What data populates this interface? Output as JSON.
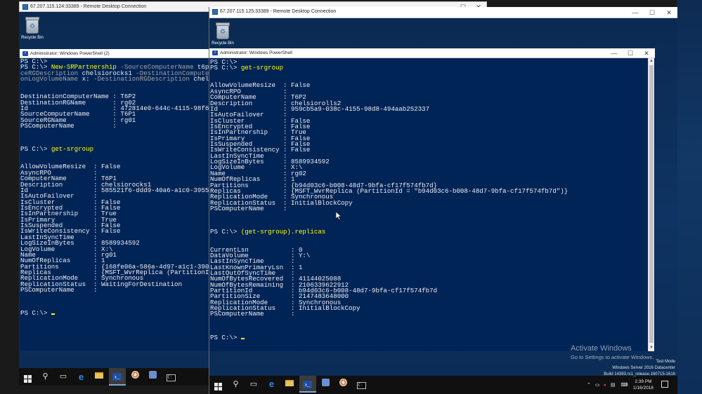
{
  "left_rdp": {
    "title": "67.207.115.124:33389 - Remote Desktop Connection",
    "recycle_bin_label": "Recycle Bin",
    "ps_window_title": "Administrator: Windows PowerShell (2)"
  },
  "left_ps_lines": [
    [
      {
        "t": "PS C:\\>",
        "c": ""
      }
    ],
    [
      {
        "t": "PS C:\\> ",
        "c": ""
      },
      {
        "t": "New-SRPartnership",
        "c": "y"
      },
      {
        "t": " -SourceComputerName",
        "c": "g"
      },
      {
        "t": " t6p1",
        "c": ""
      }
    ],
    [
      {
        "t": "ceRGDescription",
        "c": "g"
      },
      {
        "t": " chelsiorocks1",
        "c": ""
      },
      {
        "t": " -DestinationComputerN",
        "c": "g"
      }
    ],
    [
      {
        "t": "onLogVolumeName",
        "c": "g"
      },
      {
        "t": " x: ",
        "c": ""
      },
      {
        "t": "-DestinationRGDescription",
        "c": "g"
      },
      {
        "t": " chelsi",
        "c": ""
      }
    ],
    [
      {
        "t": "",
        "c": ""
      }
    ],
    [
      {
        "t": "",
        "c": ""
      }
    ],
    [
      {
        "t": "DestinationComputerName : T6P2",
        "c": ""
      }
    ],
    [
      {
        "t": "DestinationRGName       : rg02",
        "c": ""
      }
    ],
    [
      {
        "t": "Id                      : 472814e0-644c-4115-98f6-a",
        "c": ""
      }
    ],
    [
      {
        "t": "SourceComputerName      : T6P1",
        "c": ""
      }
    ],
    [
      {
        "t": "SourceRGName            : rg01",
        "c": ""
      }
    ],
    [
      {
        "t": "PSComputerName          :",
        "c": ""
      }
    ],
    [
      {
        "t": "",
        "c": ""
      }
    ],
    [
      {
        "t": "",
        "c": ""
      }
    ],
    [
      {
        "t": "",
        "c": ""
      }
    ],
    [
      {
        "t": "PS C:\\> ",
        "c": ""
      },
      {
        "t": "get-srgroup",
        "c": "y"
      }
    ],
    [
      {
        "t": "",
        "c": ""
      }
    ],
    [
      {
        "t": "",
        "c": ""
      }
    ],
    [
      {
        "t": "AllowVolumeResize  : False",
        "c": ""
      }
    ],
    [
      {
        "t": "AsyncRPO           :",
        "c": ""
      }
    ],
    [
      {
        "t": "ComputerName       : T6P1",
        "c": ""
      }
    ],
    [
      {
        "t": "Description        : chelsiorocks1",
        "c": ""
      }
    ],
    [
      {
        "t": "Id                 : 585521f6-ddd9-40a6-a1c0-3955f4",
        "c": ""
      }
    ],
    [
      {
        "t": "IsAutoFailover     :",
        "c": ""
      }
    ],
    [
      {
        "t": "IsCluster          : False",
        "c": ""
      }
    ],
    [
      {
        "t": "IsEncrypted        : False",
        "c": ""
      }
    ],
    [
      {
        "t": "IsInPartnership    : True",
        "c": ""
      }
    ],
    [
      {
        "t": "IsPrimary          : True",
        "c": ""
      }
    ],
    [
      {
        "t": "IsSuspended        : False",
        "c": ""
      }
    ],
    [
      {
        "t": "IsWriteConsistency : False",
        "c": ""
      }
    ],
    [
      {
        "t": "LastInSyncTime     :",
        "c": ""
      }
    ],
    [
      {
        "t": "LogSizeInBytes     : 8589934592",
        "c": ""
      }
    ],
    [
      {
        "t": "LogVolume          : X:\\",
        "c": ""
      }
    ],
    [
      {
        "t": "Name               : rg01",
        "c": ""
      }
    ],
    [
      {
        "t": "NumOfReplicas      : 1",
        "c": ""
      }
    ],
    [
      {
        "t": "Partitions         : {168fe06a-586a-4d97-a1c1-3907b",
        "c": ""
      }
    ],
    [
      {
        "t": "Replicas           : {MSFT_WvrReplica (PartitionId",
        "c": ""
      }
    ],
    [
      {
        "t": "ReplicationMode    : Synchronous",
        "c": ""
      }
    ],
    [
      {
        "t": "ReplicationStatus  : WaitingForDestination",
        "c": ""
      }
    ],
    [
      {
        "t": "PSComputerName     :",
        "c": ""
      }
    ],
    [
      {
        "t": "",
        "c": ""
      }
    ],
    [
      {
        "t": "",
        "c": ""
      }
    ],
    [
      {
        "t": "",
        "c": ""
      }
    ],
    [
      {
        "t": "PS C:\\> ",
        "c": ""
      },
      {
        "t": "",
        "c": "cursor"
      }
    ]
  ],
  "left_taskbar": [
    "start-button",
    "search-icon",
    "task-view-icon",
    "internet-explorer-icon",
    "file-explorer-icon",
    "powershell-icon",
    "disk-icon",
    "server-manager-icon",
    "cmd-icon"
  ],
  "right_rdp": {
    "title": "67.207.115.125:33389 - Remote Desktop Connection",
    "recycle_bin_label": "Recycle Bin",
    "ps_window_title": "Administrator: Windows PowerShell",
    "watermark_title": "Activate Windows",
    "watermark_sub": "Go to Settings to activate Windows.",
    "build_line1": "Test Mode",
    "build_line2": "Windows Server 2016 Datacenter",
    "build_line3": "Build 14393.rs1_release.160715-1616",
    "clock_time": "2:39 PM",
    "clock_date": "1/16/2018"
  },
  "right_ps_lines": [
    [
      {
        "t": "PS C:\\>",
        "c": ""
      }
    ],
    [
      {
        "t": "PS C:\\> ",
        "c": ""
      },
      {
        "t": "get-srgroup",
        "c": "y"
      }
    ],
    [
      {
        "t": "",
        "c": ""
      }
    ],
    [
      {
        "t": "",
        "c": ""
      }
    ],
    [
      {
        "t": "AllowVolumeResize  : False",
        "c": ""
      }
    ],
    [
      {
        "t": "AsyncRPO           :",
        "c": ""
      }
    ],
    [
      {
        "t": "ComputerName       : T6P2",
        "c": ""
      }
    ],
    [
      {
        "t": "Description        : chelsiorolls2",
        "c": ""
      }
    ],
    [
      {
        "t": "Id                 : 959cb5a9-038c-4155-98d8-494aab252337",
        "c": ""
      }
    ],
    [
      {
        "t": "IsAutoFailover     :",
        "c": ""
      }
    ],
    [
      {
        "t": "IsCluster          : False",
        "c": ""
      }
    ],
    [
      {
        "t": "IsEncrypted        : False",
        "c": ""
      }
    ],
    [
      {
        "t": "IsInPartnership    : True",
        "c": ""
      }
    ],
    [
      {
        "t": "IsPrimary          : False",
        "c": ""
      }
    ],
    [
      {
        "t": "IsSuspended        : False",
        "c": ""
      }
    ],
    [
      {
        "t": "IsWriteConsistency : False",
        "c": ""
      }
    ],
    [
      {
        "t": "LastInSyncTime     :",
        "c": ""
      }
    ],
    [
      {
        "t": "LogSizeInBytes     : 8589934592",
        "c": ""
      }
    ],
    [
      {
        "t": "LogVolume          : X:\\",
        "c": ""
      }
    ],
    [
      {
        "t": "Name               : rg02",
        "c": ""
      }
    ],
    [
      {
        "t": "NumOfReplicas      : 1",
        "c": ""
      }
    ],
    [
      {
        "t": "Partitions         : {b94d03c6-b008-48d7-9bfa-cf17f574fb7d}",
        "c": ""
      }
    ],
    [
      {
        "t": "Replicas           : {MSFT_WvrReplica (PartitionId = \"b94d03c6-b008-48d7-9bfa-cf17f574fb7d\")}",
        "c": ""
      }
    ],
    [
      {
        "t": "ReplicationMode    : Synchronous",
        "c": ""
      }
    ],
    [
      {
        "t": "ReplicationStatus  : InitialBlockCopy",
        "c": ""
      }
    ],
    [
      {
        "t": "PSComputerName     :",
        "c": ""
      }
    ],
    [
      {
        "t": "",
        "c": ""
      }
    ],
    [
      {
        "t": "",
        "c": ""
      }
    ],
    [
      {
        "t": "",
        "c": ""
      }
    ],
    [
      {
        "t": "PS C:\\> ",
        "c": ""
      },
      {
        "t": "(get-srgroup).replicas",
        "c": "y"
      }
    ],
    [
      {
        "t": "",
        "c": ""
      }
    ],
    [
      {
        "t": "",
        "c": ""
      }
    ],
    [
      {
        "t": "CurrentLsn           : 0",
        "c": ""
      }
    ],
    [
      {
        "t": "DataVolume           : Y:\\",
        "c": ""
      }
    ],
    [
      {
        "t": "LastInSyncTime       :",
        "c": ""
      }
    ],
    [
      {
        "t": "LastKnownPrimaryLsn  : 1",
        "c": ""
      }
    ],
    [
      {
        "t": "LastOutOfSyncTime    :",
        "c": ""
      }
    ],
    [
      {
        "t": "NumOfBytesRecovered  : 41144025088",
        "c": ""
      }
    ],
    [
      {
        "t": "NumOfBytesRemaining  : 2106339622912",
        "c": ""
      }
    ],
    [
      {
        "t": "PartitionId          : b94d03c6-b008-48d7-9bfa-cf17f574fb7d",
        "c": ""
      }
    ],
    [
      {
        "t": "PartitionSize        : 2147483648000",
        "c": ""
      }
    ],
    [
      {
        "t": "ReplicationMode      : Synchronous",
        "c": ""
      }
    ],
    [
      {
        "t": "ReplicationStatus    : InitialBlockCopy",
        "c": ""
      }
    ],
    [
      {
        "t": "PSComputerName       :",
        "c": ""
      }
    ],
    [
      {
        "t": "",
        "c": ""
      }
    ],
    [
      {
        "t": "",
        "c": ""
      }
    ],
    [
      {
        "t": "",
        "c": ""
      }
    ],
    [
      {
        "t": "PS C:\\> ",
        "c": ""
      },
      {
        "t": "",
        "c": "cursor"
      }
    ]
  ],
  "right_taskbar": [
    "start-button",
    "search-icon",
    "task-view-icon",
    "internet-explorer-icon",
    "file-explorer-icon",
    "powershell-icon",
    "server-manager-icon",
    "disk-icon",
    "cmd-icon"
  ],
  "window_controls": {
    "minimize": "—",
    "maximize": "☐",
    "close": "✕"
  },
  "colors": {
    "ps_background": "#012456",
    "ps_text": "#eeedf0",
    "ps_command": "#ffff00",
    "ps_param": "#a0a0a0",
    "desktop": "#0d3463",
    "taskbar": "#101010"
  }
}
